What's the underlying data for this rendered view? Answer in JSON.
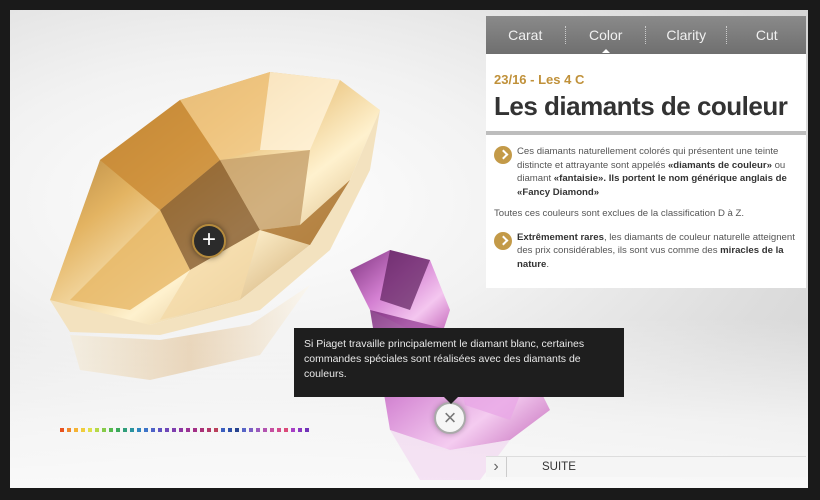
{
  "tabs": [
    {
      "label": "Carat"
    },
    {
      "label": "Color",
      "active": true
    },
    {
      "label": "Clarity"
    },
    {
      "label": "Cut"
    }
  ],
  "panel": {
    "subtitle": "23/16 - Les 4 C",
    "title": "Les diamants de couleur",
    "p1_a": "Ces diamants naturellement colorés qui présentent une teinte distincte et attrayante sont appelés ",
    "p1_b": "«diamants de couleur»",
    "p1_c": " ou diamant ",
    "p1_d": "«fantaisie»",
    "p1_e": ". Ils portent le nom générique anglais de «Fancy Diamond»",
    "p2": "Toutes ces couleurs sont exclues de la classification D à Z.",
    "p3_a": "Extrêmement rares",
    "p3_b": ", les diamants de couleur naturelle atteignent des prix considérables, ils sont vus comme des ",
    "p3_c": "miracles de la nature",
    "p3_d": "."
  },
  "tooltip": {
    "text": "Si Piaget travaille principalement le diamant blanc, certaines commandes spéciales sont réalisées avec des diamants de couleurs."
  },
  "controls": {
    "zoom_symbol": "+",
    "close_symbol": "×",
    "suite_label": "SUITE",
    "suite_arrow": "›"
  },
  "colors": {
    "accent": "#c0913a",
    "tab_bar": "#7c7c7c",
    "gem_gold": "#d19a3c",
    "gem_pink": "#c86ab8"
  },
  "swatch_colors": [
    "#e8531f",
    "#f0872a",
    "#f5b334",
    "#f0cd3c",
    "#dfe04a",
    "#b6d948",
    "#86cb49",
    "#55b94d",
    "#3ba85a",
    "#2f9e7a",
    "#2a93a0",
    "#2f86c0",
    "#3d74c8",
    "#4e62c8",
    "#5e52c1",
    "#6f47b8",
    "#7f3eaf",
    "#8e37a3",
    "#9a3295",
    "#a32f86",
    "#aa3177",
    "#b23869",
    "#ba405b",
    "#3b5fc0",
    "#2e4fa8",
    "#27438f",
    "#5865c7",
    "#7b5fc4",
    "#9a59bd",
    "#b353b0",
    "#c64fa0",
    "#d34b8d",
    "#db4a79",
    "#a73fc6",
    "#8a37c1",
    "#7133b8"
  ]
}
